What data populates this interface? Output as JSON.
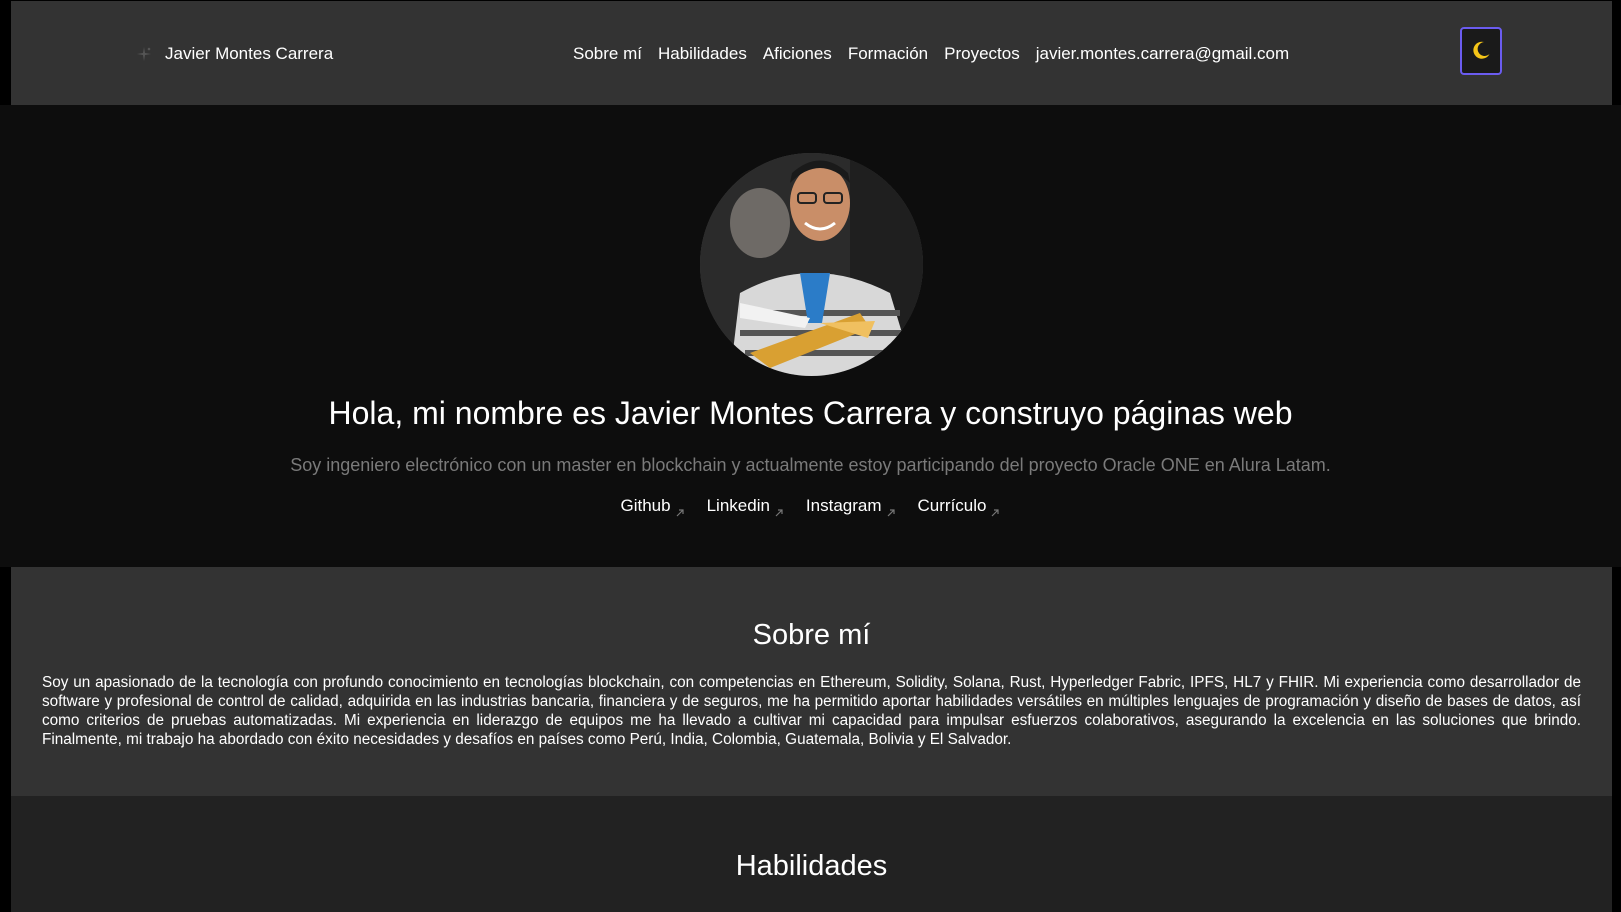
{
  "colors": {
    "navbar_bg": "#333333",
    "hero_bg": "#0d0d0d",
    "about_bg": "#333333",
    "skills_bg": "#222222",
    "toggle_border": "#6b5cf0",
    "subtitle_text": "#7a7a7a"
  },
  "header": {
    "brand_icon": "sparkle-icon",
    "brand_name": "Javier Montes Carrera",
    "nav": [
      {
        "label": "Sobre mí"
      },
      {
        "label": "Habilidades"
      },
      {
        "label": "Aficiones"
      },
      {
        "label": "Formación"
      },
      {
        "label": "Proyectos"
      },
      {
        "label": "javier.montes.carrera@gmail.com"
      }
    ],
    "theme_toggle_icon": "moon-icon"
  },
  "hero": {
    "avatar_icon": "profile-photo",
    "title": "Hola, mi nombre es Javier Montes Carrera y construyo páginas web",
    "subtitle": "Soy ingeniero electrónico con un master en blockchain y actualmente estoy participando del proyecto Oracle ONE en Alura Latam.",
    "links": [
      {
        "label": "Github",
        "icon": "external-link-icon"
      },
      {
        "label": "Linkedin",
        "icon": "external-link-icon"
      },
      {
        "label": "Instagram",
        "icon": "external-link-icon"
      },
      {
        "label": "Currículo",
        "icon": "external-link-icon"
      }
    ]
  },
  "about": {
    "title": "Sobre mí",
    "text": "Soy un apasionado de la tecnología con profundo conocimiento en tecnologías blockchain, con competencias en Ethereum, Solidity, Solana, Rust, Hyperledger Fabric, IPFS, HL7 y FHIR. Mi experiencia como desarrollador de software y profesional de control de calidad, adquirida en las industrias bancaria, financiera y de seguros, me ha permitido aportar habilidades versátiles en múltiples lenguajes de programación y diseño de bases de datos, así como criterios de pruebas automatizadas. Mi experiencia en liderazgo de equipos me ha llevado a cultivar mi capacidad para impulsar esfuerzos colaborativos, asegurando la excelencia en las soluciones que brindo. Finalmente, mi trabajo ha abordado con éxito necesidades y desafíos en países como Perú, India, Colombia, Guatemala, Bolivia y El Salvador."
  },
  "skills": {
    "title": "Habilidades"
  }
}
